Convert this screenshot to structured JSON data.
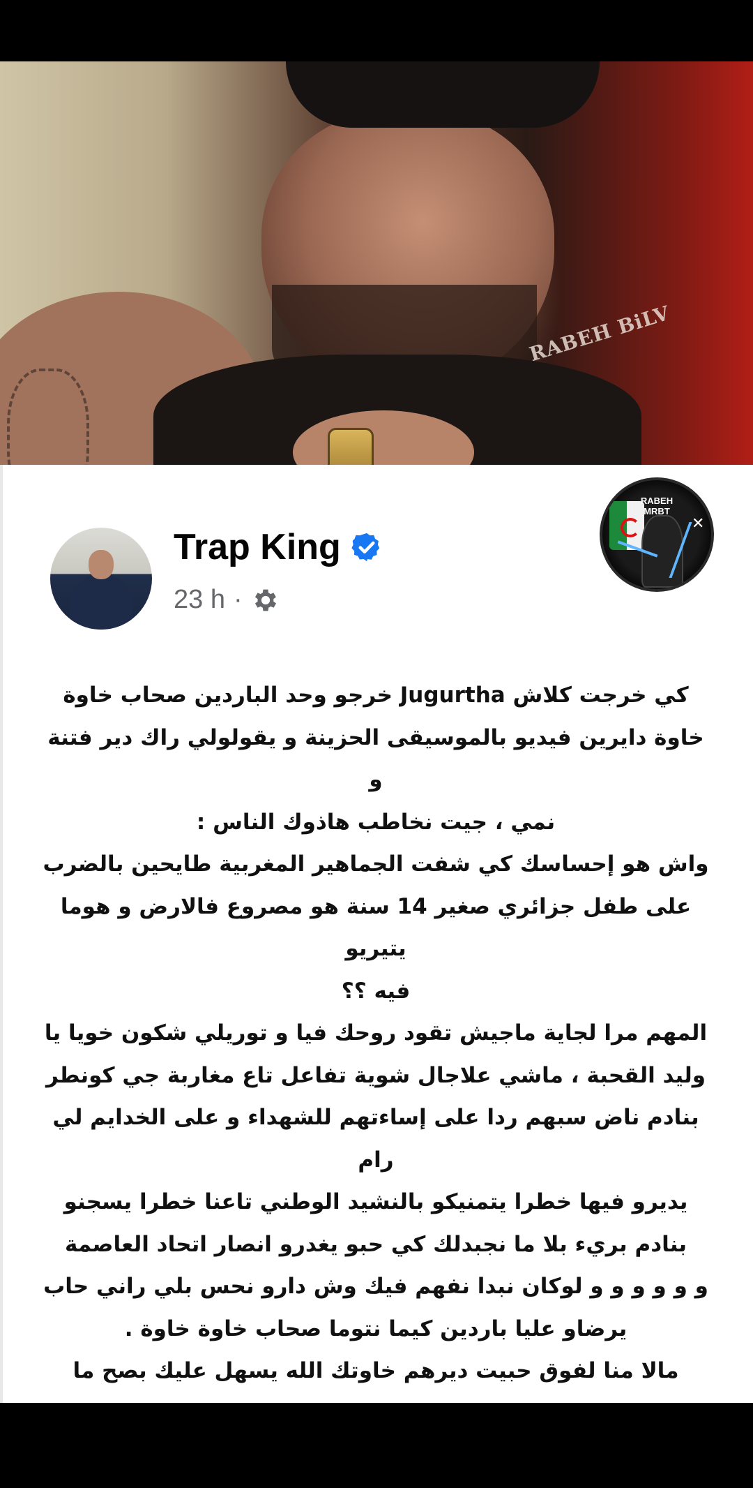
{
  "hero": {
    "watermark": "RABEH BiLV"
  },
  "post": {
    "author": "Trap King",
    "verified": true,
    "time": "23 h",
    "separator": "·",
    "privacy_icon": "gear-icon",
    "paragraphs": [
      "كي خرجت كلاش Jugurtha خرجو وحد الباردين صحاب خاوة\nخاوة دايرين فيديو بالموسيقى الحزينة و يقولولي راك دير فتنة و\nنمي ، جيت نخاطب هاذوك الناس :",
      "واش هو إحساسك كي شفت الجماهير المغربية طايحين بالضرب\nعلى طفل جزائري صغير 14 سنة هو مصروع فالارض و هوما يتيريو\nفيه ؟؟",
      "المهم مرا لجاية ماجيش تقود روحك فيا و توريلي شكون خويا يا\nوليد القحبة ، ماشي علاجال شوية تفاعل تاع مغاربة جي كونطر\nبنادم ناض سبهم ردا على إساءتهم للشهداء و على الخدايم لي رام\nيديرو فيها خطرا يتمنيكو بالنشيد الوطني تاعنا خطرا يسجنو\nبنادم بريء بلا ما نجبدلك كي حبو يغدرو انصار اتحاد العاصمة\nو و و و و و لوكان نبدا نفهم فيك وش دارو نحس بلي راني حاب\nيرضاو عليا باردين كيما نتوما صحاب خاوة خاوة .",
      "مالا منا لفوق حبيت ديرهم خاوتك الله يسهل عليك بصح ما\nتقودش روحك فواش ندير انا نيكمك و نتوما لي ما تمثلونيش\nماشي انا لي ما نمثلكمش يا ولاد القحاب، وشكرا."
    ]
  },
  "badge": {
    "text": "RABEH\nMRBT"
  },
  "colors": {
    "verified_blue": "#1877f2",
    "meta_gray": "#65676b"
  }
}
